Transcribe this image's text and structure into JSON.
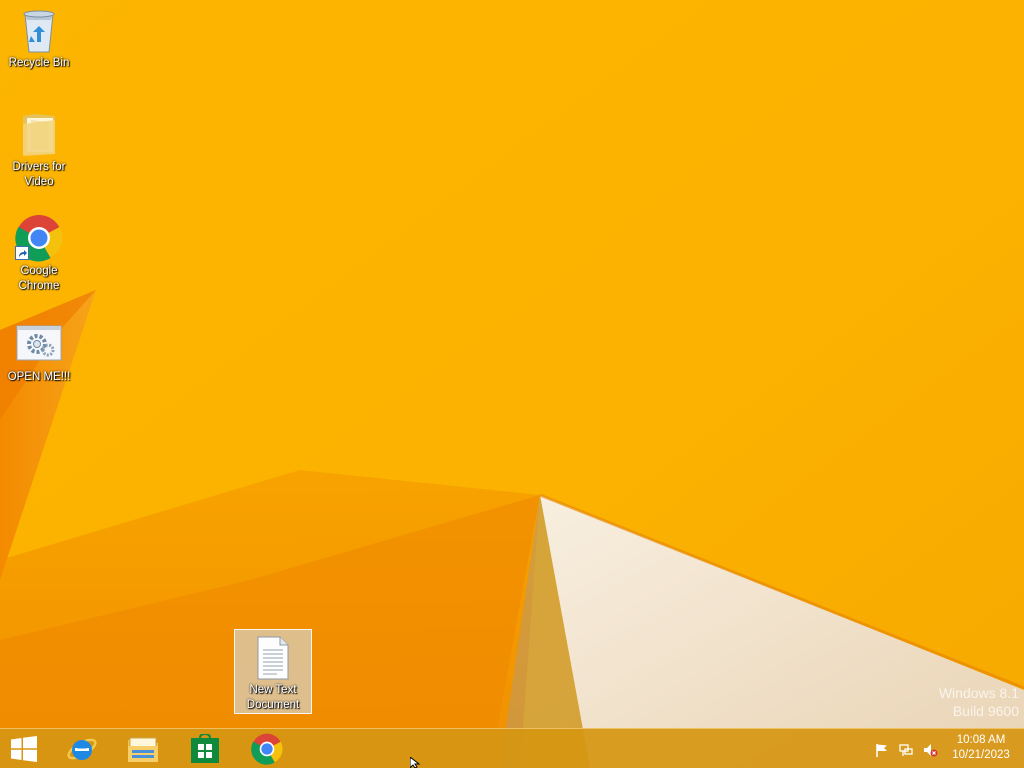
{
  "desktop": {
    "icons": [
      {
        "label": "Recycle Bin"
      },
      {
        "label": "Drivers for\nVideo"
      },
      {
        "label": "Google\nChrome"
      },
      {
        "label": "OPEN ME!!!"
      },
      {
        "label": "New Text\nDocument"
      }
    ]
  },
  "watermark": {
    "line1": "Windows 8.1",
    "line2": "Build 9600"
  },
  "taskbar": {
    "pinned": [
      "start-icon",
      "internet-explorer-icon",
      "file-explorer-icon",
      "store-icon",
      "chrome-icon"
    ],
    "tray": [
      "action-center-flag-icon",
      "network-icon",
      "volume-muted-icon"
    ],
    "clock": {
      "time": "10:08 AM",
      "date": "10/21/2023"
    }
  },
  "colors": {
    "wallpaper": "#fbb400",
    "wallpaper_dark": "#f08a00",
    "taskbar": "#d69612",
    "accent_white": "#ffffff"
  }
}
